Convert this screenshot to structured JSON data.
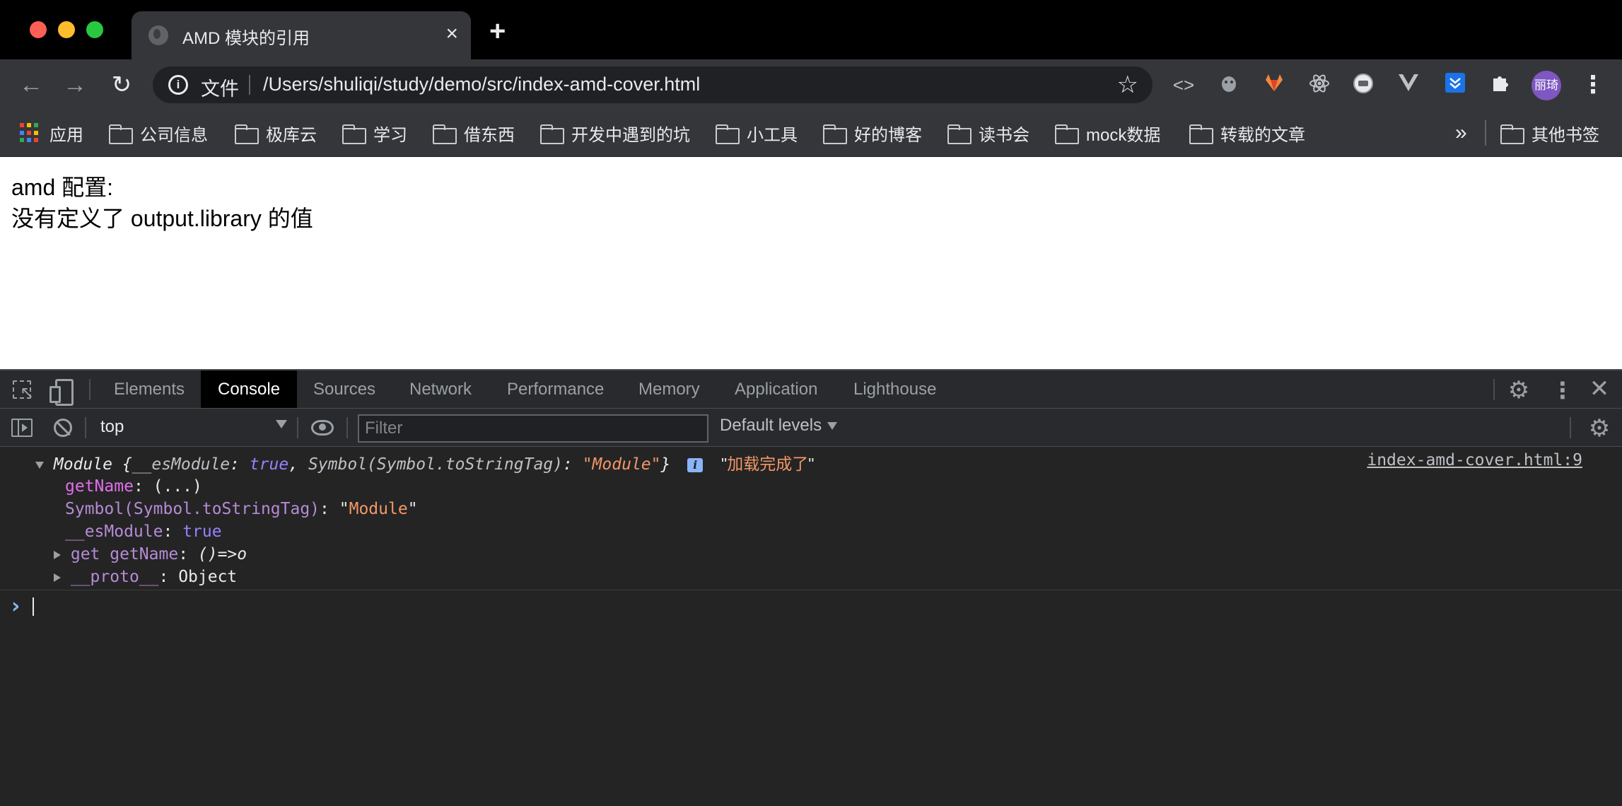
{
  "window": {
    "tab_title": "AMD 模块的引用",
    "tab_close": "×",
    "new_tab": "+"
  },
  "toolbar": {
    "back": "←",
    "forward": "→",
    "reload": "↻",
    "scheme_label": "文件",
    "url": "/Users/shuliqi/study/demo/src/index-amd-cover.html",
    "star": "☆",
    "avatar_text": "丽琦",
    "menu": "⋮"
  },
  "bookmarks": {
    "items": [
      {
        "label": "应用",
        "icon": "apps-icon"
      },
      {
        "label": "公司信息",
        "icon": "folder-icon"
      },
      {
        "label": "极库云",
        "icon": "folder-icon"
      },
      {
        "label": "学习",
        "icon": "folder-icon"
      },
      {
        "label": "借东西",
        "icon": "folder-icon"
      },
      {
        "label": "开发中遇到的坑",
        "icon": "folder-icon"
      },
      {
        "label": "小工具",
        "icon": "folder-icon"
      },
      {
        "label": "好的博客",
        "icon": "folder-icon"
      },
      {
        "label": "读书会",
        "icon": "folder-icon"
      },
      {
        "label": "mock数据",
        "icon": "folder-icon"
      },
      {
        "label": "转载的文章",
        "icon": "folder-icon"
      }
    ],
    "more": "»",
    "other_bookmarks": "其他书签"
  },
  "page": {
    "line1": "amd 配置:",
    "line2": "没有定义了 output.library 的值"
  },
  "devtools": {
    "tabs": [
      "Elements",
      "Console",
      "Sources",
      "Network",
      "Performance",
      "Memory",
      "Application",
      "Lighthouse"
    ],
    "active_tab": "Console",
    "context": "top",
    "filter_placeholder": "Filter",
    "levels": "Default levels",
    "console": {
      "log": {
        "module": "Module",
        "esmodule_key": "__esModule",
        "esmodule_val": "true",
        "symbol_key": "Symbol(Symbol.toStringTag)",
        "symbol_val": "\"Module\"",
        "message": "\"加载完成了\"",
        "source": "index-amd-cover.html:9",
        "children": {
          "getname_key": "getName",
          "getname_val": "(...)",
          "symbol_key": "Symbol(Symbol.toStringTag)",
          "symbol_val_open": "\"",
          "symbol_val": "Module",
          "symbol_val_close": "\"",
          "esmodule_key": "__esModule",
          "esmodule_val": "true",
          "getter_key": "get getName",
          "getter_val": "()=>o",
          "proto_key": "__proto__",
          "proto_val": "Object"
        }
      },
      "prompt": "›"
    }
  },
  "colors": {
    "accent_blue": "#8ab4f8",
    "string_orange": "#f29766",
    "key_pink": "#e36eec",
    "bool_purple": "#9980ff",
    "traffic_red": "#ff5f57",
    "traffic_yellow": "#febc2e",
    "traffic_green": "#28c840"
  }
}
